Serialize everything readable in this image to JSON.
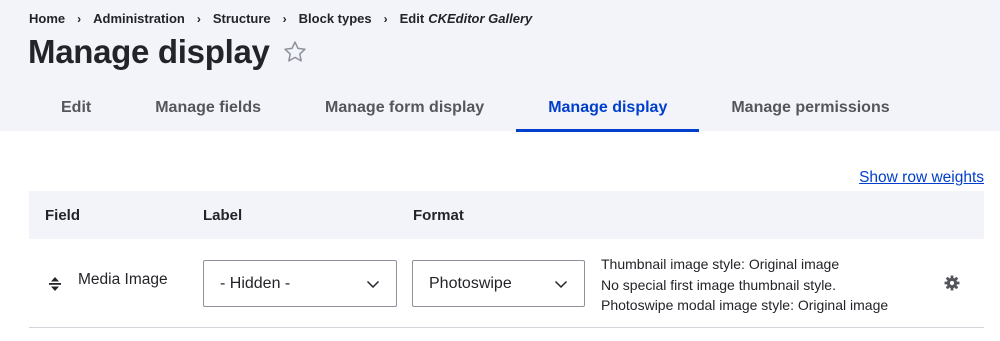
{
  "breadcrumb": {
    "items": [
      "Home",
      "Administration",
      "Structure",
      "Block types"
    ],
    "current_prefix": "Edit",
    "current": "CKEditor Gallery",
    "separator": "›"
  },
  "page": {
    "title": "Manage display"
  },
  "tabs": [
    {
      "label": "Edit",
      "active": false
    },
    {
      "label": "Manage fields",
      "active": false
    },
    {
      "label": "Manage form display",
      "active": false
    },
    {
      "label": "Manage display",
      "active": true
    },
    {
      "label": "Manage permissions",
      "active": false
    }
  ],
  "table": {
    "show_row_weights": "Show row weights",
    "headers": {
      "field": "Field",
      "label": "Label",
      "format": "Format"
    },
    "rows": [
      {
        "field": "Media Image",
        "label_value": "- Hidden -",
        "format_value": "Photoswipe",
        "summary": [
          "Thumbnail image style: Original image",
          "No special first image thumbnail style.",
          "Photoswipe modal image style: Original image"
        ]
      }
    ]
  },
  "icons": {
    "star": "star-outline-icon",
    "drag": "drag-handle-icon",
    "chevron": "chevron-down-icon",
    "gear": "gear-icon"
  },
  "colors": {
    "accent": "#003ecc",
    "header_bg": "#f3f4f9",
    "text": "#232429"
  }
}
